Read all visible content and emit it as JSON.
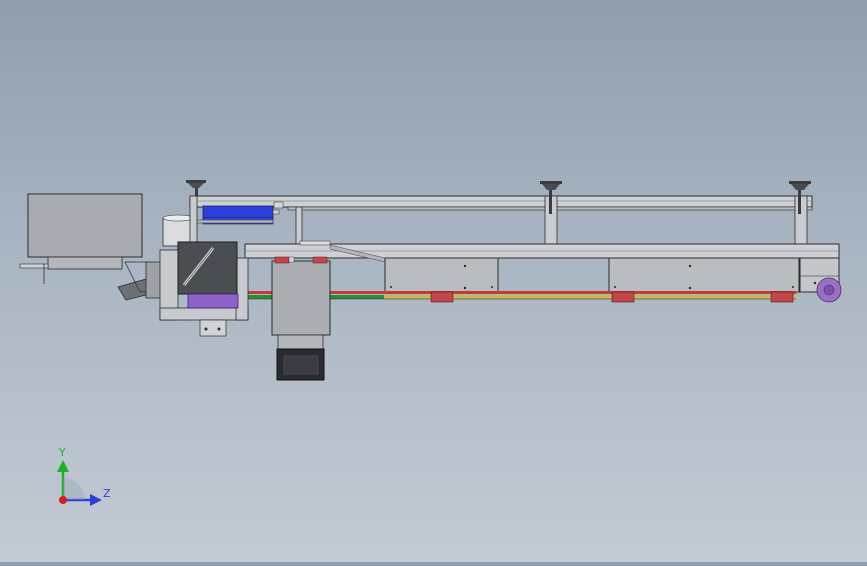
{
  "triad": {
    "y_label": "Y",
    "z_label": "Z",
    "colors": {
      "y_axis": "#1fae2b",
      "z_axis": "#2b3fd6",
      "origin": "#d21f1f"
    }
  },
  "colors": {
    "frame": "#c9ccd0",
    "frame_line": "#2b2b2b",
    "panel": "#b9bcc0",
    "dark_unit": "#4a4d52",
    "blue_cylinder": "#2f3fd8",
    "purple_block": "#8d63c9",
    "red_rail": "#c23a3a",
    "green_rail": "#2e8c34",
    "yellow_rail": "#c9b84a",
    "purple_wheel": "#9b6fc6"
  },
  "view": {
    "orientation": "front",
    "background": "gradient"
  }
}
